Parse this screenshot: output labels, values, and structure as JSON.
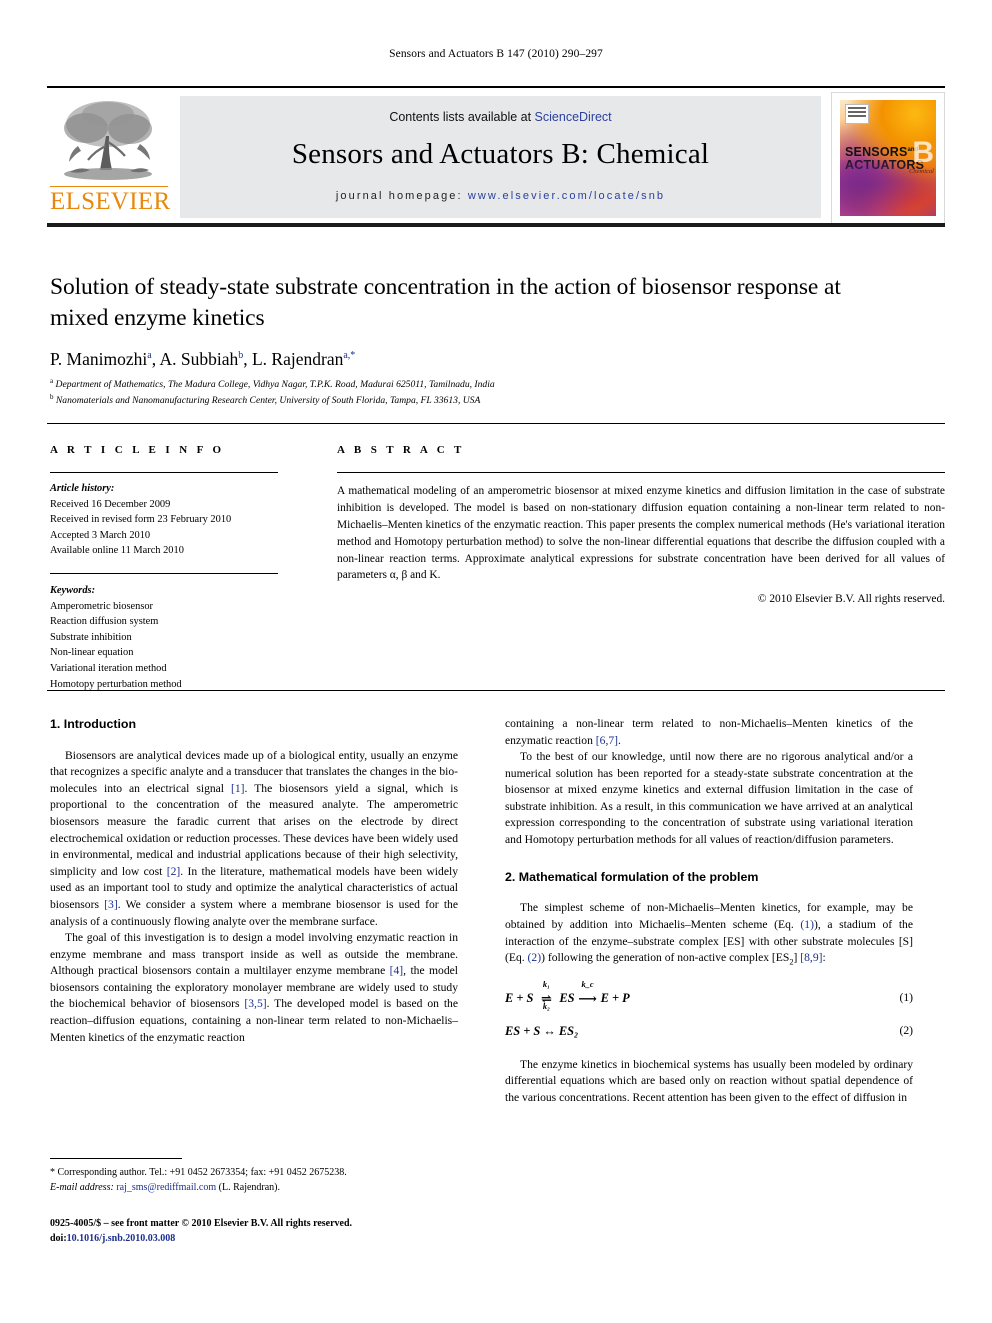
{
  "running_head": "Sensors and Actuators B 147 (2010) 290–297",
  "masthead": {
    "publisher": "ELSEVIER",
    "contents_prefix": "Contents lists available at ",
    "contents_link": "ScienceDirect",
    "journal_title": "Sensors and Actuators B: Chemical",
    "homepage_label": "journal homepage:",
    "homepage_url": "www.elsevier.com/locate/snb",
    "cover": {
      "line1": "SENSORS",
      "line1_small": "and",
      "line2": "ACTUATORS",
      "letter": "B",
      "sublabel": "Chemical"
    }
  },
  "article": {
    "title": "Solution of steady-state substrate concentration in the action of biosensor response at mixed enzyme kinetics",
    "authors": "P. Manimozhi, A. Subbiah, L. Rajendran",
    "author_list": [
      {
        "name": "P. Manimozhi",
        "marks": "a"
      },
      {
        "name": "A. Subbiah",
        "marks": "b"
      },
      {
        "name": "L. Rajendran",
        "marks": "a,*"
      }
    ],
    "affiliations": [
      {
        "mark": "a",
        "text": "Department of Mathematics, The Madura College, Vidhya Nagar, T.P.K. Road, Madurai 625011, Tamilnadu, India"
      },
      {
        "mark": "b",
        "text": "Nanomaterials and Nanomanufacturing Research Center, University of South Florida, Tampa, FL 33613, USA"
      }
    ]
  },
  "article_info": {
    "heading": "A R T I C L E  I N F O",
    "history_label": "Article history:",
    "history": [
      "Received 16 December 2009",
      "Received in revised form 23 February 2010",
      "Accepted 3 March 2010",
      "Available online 11 March 2010"
    ],
    "keywords_label": "Keywords:",
    "keywords": [
      "Amperometric biosensor",
      "Reaction diffusion system",
      "Substrate inhibition",
      "Non-linear equation",
      "Variational iteration method",
      "Homotopy perturbation method"
    ]
  },
  "abstract": {
    "heading": "A B S T R A C T",
    "text": "A mathematical modeling of an amperometric biosensor at mixed enzyme kinetics and diffusion limitation in the case of substrate inhibition is developed. The model is based on non-stationary diffusion equation containing a non-linear term related to non-Michaelis–Menten kinetics of the enzymatic reaction. This paper presents the complex numerical methods (He's variational iteration method and Homotopy perturbation method) to solve the non-linear differential equations that describe the diffusion coupled with a non-linear reaction terms. Approximate analytical expressions for substrate concentration have been derived for all values of parameters α, β and K.",
    "copyright": "© 2010 Elsevier B.V. All rights reserved."
  },
  "sections": {
    "introduction": {
      "heading": "1. Introduction",
      "p1_a": "Biosensors are analytical devices made up of a biological entity, usually an enzyme that recognizes a specific analyte and a transducer that translates the changes in the bio-molecules into an electrical signal ",
      "p1_c1": "[1]",
      "p1_b": ". The biosensors yield a signal, which is proportional to the concentration of the measured analyte. The amperometric biosensors measure the faradic current that arises on the electrode by direct electrochemical oxidation or reduction processes. These devices have been widely used in environmental, medical and industrial applications because of their high selectivity, simplicity and low cost ",
      "p1_c2": "[2]",
      "p1_d": ". In the literature, mathematical models have been widely used as an important tool to study and optimize the analytical characteristics of actual biosensors ",
      "p1_c3": "[3]",
      "p1_e": ". We consider a system where a membrane biosensor is used for the analysis of a continuously flowing analyte over the membrane surface.",
      "p2_a": "The goal of this investigation is to design a model involving enzymatic reaction in enzyme membrane and mass transport inside as well as outside the membrane. Although practical biosensors contain a multilayer enzyme membrane ",
      "p2_c1": "[4]",
      "p2_b": ", the model biosensors containing the exploratory monolayer membrane are widely used to study the biochemical behavior of biosensors ",
      "p2_c2": "[3,5]",
      "p2_c": ". The developed model is based on the reaction–diffusion equations, containing a non-linear term related to non-Michaelis–Menten kinetics of the enzymatic reaction ",
      "p2_c3": "[6,7]",
      "p2_d": ".",
      "p3": "To the best of our knowledge, until now there are no rigorous analytical and/or a numerical solution has been reported for a steady-state substrate concentration at the biosensor at mixed enzyme kinetics and external diffusion limitation in the case of substrate inhibition. As a result, in this communication we have arrived at an analytical expression corresponding to the concentration of substrate using variational iteration and Homotopy perturbation methods for all values of reaction/diffusion parameters."
    },
    "formulation": {
      "heading": "2. Mathematical formulation of the problem",
      "p1_a": "The simplest scheme of non-Michaelis–Menten kinetics, for example, may be obtained by addition into Michaelis–Menten scheme (Eq. ",
      "p1_c1": "(1)",
      "p1_b": "), a stadium of the interaction of the enzyme–substrate complex [ES] with other substrate molecules [S] (Eq. ",
      "p1_c2": "(2)",
      "p1_c": ") following the generation of non-active complex [ES",
      "p1_sub": "2",
      "p1_d": "] ",
      "p1_c3": "[8,9]",
      "p1_e": ":",
      "eq1": {
        "lhs": "E + S",
        "k_top": "k₁",
        "k_bot": "k₂",
        "mid": "ES",
        "kc": "k_c",
        "rhs": "E + P",
        "number": "(1)"
      },
      "eq2": {
        "text": "ES + S ↔ ES₂",
        "number": "(2)"
      },
      "p2": "The enzyme kinetics in biochemical systems has usually been modeled by ordinary differential equations which are based only on reaction without spatial dependence of the various concentrations. Recent attention has been given to the effect of diffusion in"
    }
  },
  "footnote": {
    "corresponding": "* Corresponding author. Tel.: +91 0452 2673354; fax: +91 0452 2675238.",
    "email_label": "E-mail address:",
    "email": "raj_sms@rediffmail.com",
    "email_owner": "(L. Rajendran)."
  },
  "imprint": {
    "line1": "0925-4005/$ – see front matter © 2010 Elsevier B.V. All rights reserved.",
    "doi_label": "doi:",
    "doi": "10.1016/j.snb.2010.03.008"
  }
}
